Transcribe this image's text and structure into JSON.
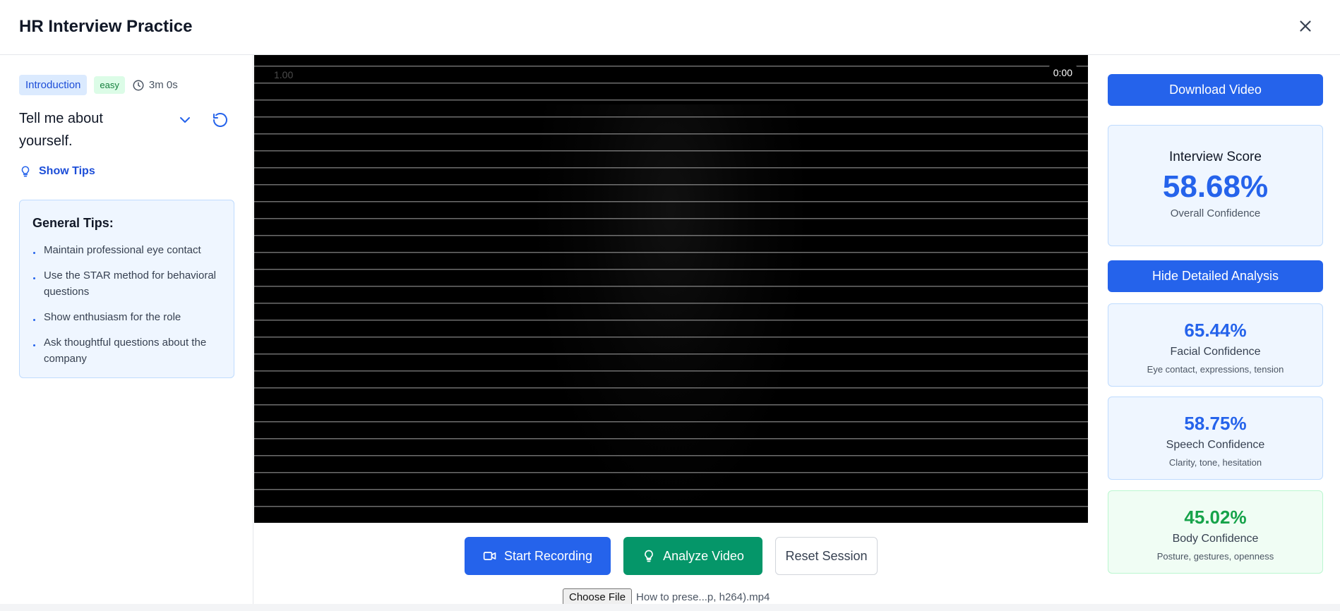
{
  "header": {
    "title": "HR Interview Practice"
  },
  "question": {
    "category": "Introduction",
    "difficulty": "easy",
    "duration": "3m 0s",
    "text": "Tell me about yourself.",
    "show_tips_label": "Show Tips"
  },
  "tips": {
    "title": "General Tips:",
    "items": [
      "Maintain professional eye contact",
      "Use the STAR method for behavioral questions",
      "Show enthusiasm for the role",
      "Ask thoughtful questions about the company"
    ]
  },
  "video": {
    "playback_rate": "1.00",
    "timer": "0:00"
  },
  "controls": {
    "start_label": "Start Recording",
    "analyze_label": "Analyze Video",
    "reset_label": "Reset Session",
    "choose_file_label": "Choose File",
    "file_name": "How to prese...p, h264).mp4"
  },
  "results": {
    "download_label": "Download Video",
    "score_title": "Interview Score",
    "score_value": "58.68%",
    "score_sub": "Overall Confidence",
    "hide_label": "Hide Detailed Analysis",
    "metrics": [
      {
        "value": "65.44%",
        "name": "Facial Confidence",
        "desc": "Eye contact, expressions, tension"
      },
      {
        "value": "58.75%",
        "name": "Speech Confidence",
        "desc": "Clarity, tone, hesitation"
      },
      {
        "value": "45.02%",
        "name": "Body Confidence",
        "desc": "Posture, gestures, openness"
      }
    ]
  },
  "colors": {
    "primary": "#2563eb",
    "success": "#059669",
    "green_metric": "#16a34a"
  },
  "icons": [
    "close-icon",
    "clock-icon",
    "chevron-down-icon",
    "refresh-icon",
    "lightbulb-icon",
    "video-camera-icon"
  ]
}
